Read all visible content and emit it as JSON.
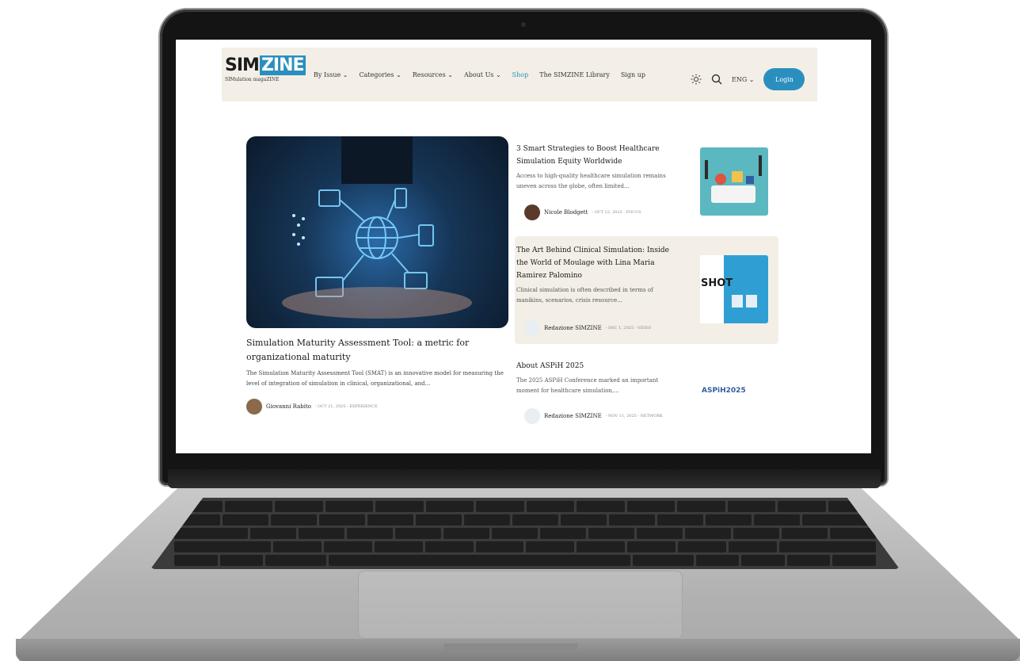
{
  "brand": {
    "logo_text_plain": "SIM",
    "logo_text_box": "ZINE",
    "tagline": "SIMulation magaZINE"
  },
  "nav": {
    "items": [
      "By Issue ⌄",
      "Categories ⌄",
      "Resources ⌄",
      "About Us ⌄",
      "Shop",
      "The SIMZINE Library",
      "Sign up"
    ],
    "language": "ENG ⌄",
    "login": "Login"
  },
  "featured": {
    "title": "Simulation Maturity Assessment Tool: a metric for organizational maturity",
    "description": "The Simulation Maturity Assessment Tool (SMAT) is an innovative model for measuring the level of integration of simulation in clinical, organizational, and...",
    "author": "Giovanni Rabito",
    "meta": "- OCT 21, 2025 - EXPERIENCE"
  },
  "articles": [
    {
      "title": "3 Smart Strategies to Boost Healthcare Simulation Equity Worldwide",
      "description": "Access to high-quality healthcare simulation remains uneven across the globe, often limited...",
      "author": "Nicole Blodgett",
      "meta": "- OCT 23, 2025 - FOCUS",
      "thumb_color": "#5bb7c0"
    },
    {
      "title": "The Art Behind Clinical Simulation: Inside the World of Moulage with Lina Maria Ramirez Palomino",
      "description": "Clinical simulation is often described in terms of manikins, scenarios, crisis resource...",
      "author": "Redazione SIMZINE",
      "meta": "- DEC 1, 2025 - VIDEO",
      "thumb_color": "#2f9fd3",
      "thumb_text": "SHOT"
    },
    {
      "title": "About ASPiH 2025",
      "description": "The 2025 ASPiH Conference marked an important moment for healthcare simulation,...",
      "author": "Redazione SIMZINE",
      "meta": "- NOV 11, 2025 - NETWORK",
      "thumb_color": "#ffffff",
      "thumb_text": "ASPiH2025"
    }
  ],
  "colors": {
    "accent": "#2a8fbf",
    "nav_bg": "#f3efe6"
  }
}
